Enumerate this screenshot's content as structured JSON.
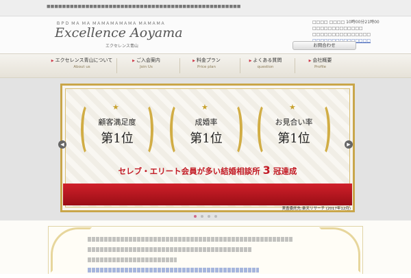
{
  "header": {
    "tagline": "ＢＰＤ ＭＡ ＭＡ ＭＡＭＡＭＡＭＡＭＡ ＭＡＭＡＭＡ",
    "logo_text": "Excellence Aoyama",
    "logo_sub": "エクセレンス青山",
    "contact_hours": "□□□□ □□□□ 10時00分21時00",
    "inquiry_label": "お問合わせ"
  },
  "nav": {
    "items": [
      {
        "label": "エクセレンス青山について",
        "sub": "About us"
      },
      {
        "label": "ご入会案内",
        "sub": "Join Us"
      },
      {
        "label": "料金プラン",
        "sub": "Price plan"
      },
      {
        "label": "よくある質問",
        "sub": "question"
      },
      {
        "label": "会社概要",
        "sub": "Profile"
      }
    ]
  },
  "banner": {
    "awards": [
      {
        "label": "顧客満足度",
        "rank": "第1位"
      },
      {
        "label": "成婚率",
        "rank": "第1位"
      },
      {
        "label": "お見合い率",
        "rank": "第1位"
      }
    ],
    "slogan_main": "セレブ・エリート会員が多い結婚相談所",
    "slogan_big": "3",
    "slogan_end": "冠達成",
    "credit": "実査委託先:楽天リサーチ (2017年12月)"
  },
  "slider": {
    "prev_icon": "chevron-left-icon",
    "next_icon": "chevron-right-icon"
  },
  "colors": {
    "accent_gold": "#c9a64a",
    "accent_red": "#c21a24"
  }
}
